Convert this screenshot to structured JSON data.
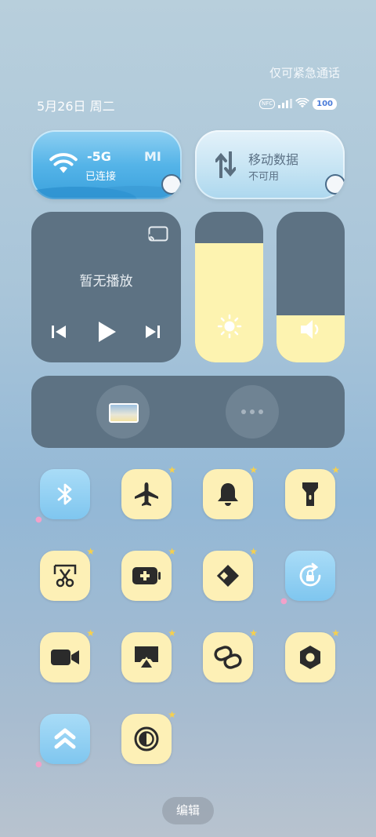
{
  "header": {
    "emergency": "仅可紧急通话",
    "date": "5月26日 周二",
    "battery": "100",
    "nfc": "NFC"
  },
  "wifi": {
    "title": "-5G",
    "brand": "MI",
    "status": "已连接"
  },
  "mobile_data": {
    "title": "移动数据",
    "status": "不可用"
  },
  "media": {
    "title": "暂无播放"
  },
  "sliders": {
    "brightness": 0.79,
    "volume": 0.31
  },
  "edit_label": "编辑",
  "colors": {
    "tile_on": "#8fcef2",
    "tile_off": "#fdf0b6",
    "panel": "#5d7283"
  },
  "tiles": [
    {
      "name": "bluetooth",
      "icon": "bluetooth-icon",
      "active": true
    },
    {
      "name": "airplane-mode",
      "icon": "airplane-icon",
      "active": false
    },
    {
      "name": "ringer",
      "icon": "bell-icon",
      "active": false
    },
    {
      "name": "flashlight",
      "icon": "flashlight-icon",
      "active": false
    },
    {
      "name": "screenshot",
      "icon": "scissors-icon",
      "active": false
    },
    {
      "name": "battery-saver",
      "icon": "battery-plus-icon",
      "active": false
    },
    {
      "name": "share",
      "icon": "send-icon",
      "active": false
    },
    {
      "name": "rotation-lock",
      "icon": "rotation-lock-icon",
      "active": true
    },
    {
      "name": "screen-record",
      "icon": "video-camera-icon",
      "active": false
    },
    {
      "name": "cast",
      "icon": "airplay-icon",
      "active": false
    },
    {
      "name": "link",
      "icon": "link-icon",
      "active": false
    },
    {
      "name": "settings",
      "icon": "hex-nut-icon",
      "active": false
    },
    {
      "name": "navigation",
      "icon": "double-chevron-up-icon",
      "active": true
    },
    {
      "name": "dark-mode",
      "icon": "contrast-icon",
      "active": false
    }
  ]
}
